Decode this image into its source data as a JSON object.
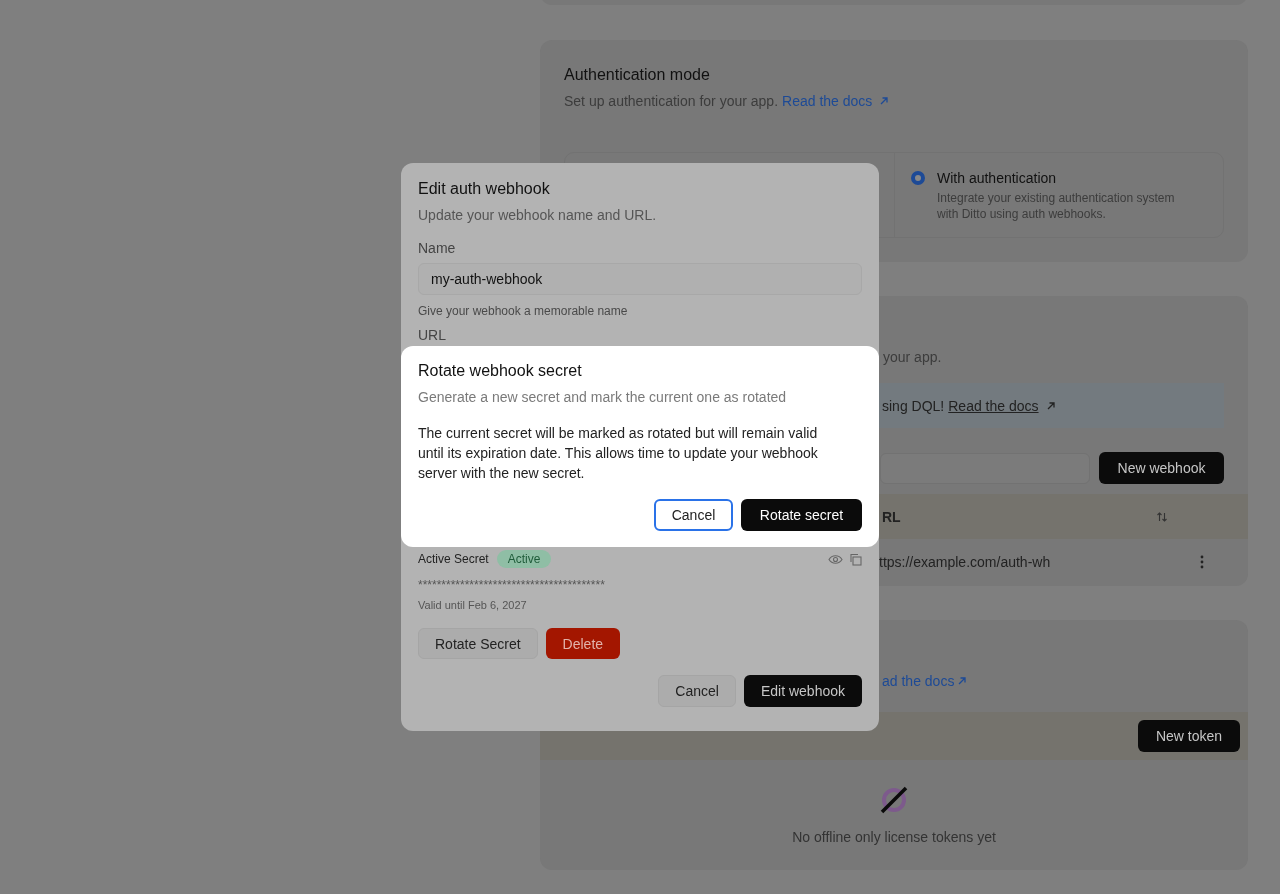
{
  "page": {
    "auth_mode": {
      "title": "Authentication mode",
      "description": "Set up authentication for your app.",
      "link": "Read the docs",
      "options": [
        {
          "kind": "hidden"
        },
        {
          "kind": "option",
          "label": "With authentication",
          "description": "Integrate your existing authentication system with Ditto using auth webhooks.",
          "selected": true
        }
      ]
    },
    "webhooks": {
      "description": "your app.",
      "banner": {
        "text": "sing DQL!",
        "link": "Read the docs"
      },
      "new_button": "New webhook",
      "columns": [
        {
          "label": "RL",
          "sortable": true
        }
      ],
      "rows": [
        {
          "url": "ttps://example.com/auth-wh"
        }
      ]
    },
    "tokens": {
      "link": "ad the docs",
      "new_button": "New token",
      "empty_text": "No offline only license tokens yet"
    }
  },
  "edit_dialog": {
    "title": "Edit auth webhook",
    "description": "Update your webhook name and URL.",
    "name_label": "Name",
    "name_value": "my-auth-webhook",
    "name_help": "Give your webhook a memorable name",
    "url_label": "URL",
    "secret": {
      "label": "Active Secret",
      "status": "Active",
      "value": "****************************************",
      "valid_until": "Valid until Feb 6, 2027"
    },
    "secret_actions": [
      {
        "label": "Rotate Secret",
        "kind": "secondary"
      },
      {
        "label": "Delete",
        "kind": "danger"
      }
    ],
    "footer": [
      {
        "label": "Cancel",
        "kind": "secondary"
      },
      {
        "label": "Edit webhook",
        "kind": "primary"
      }
    ]
  },
  "rotate_dialog": {
    "title": "Rotate webhook secret",
    "description": "Generate a new secret and mark the current one as rotated",
    "body": "The current secret will be marked as rotated but will remain valid until its expiration date. This allows time to update your webhook server with the new secret.",
    "buttons": [
      {
        "label": "Cancel",
        "kind": "outline",
        "focused": true
      },
      {
        "label": "Rotate secret",
        "kind": "primary",
        "focused": false
      }
    ]
  }
}
